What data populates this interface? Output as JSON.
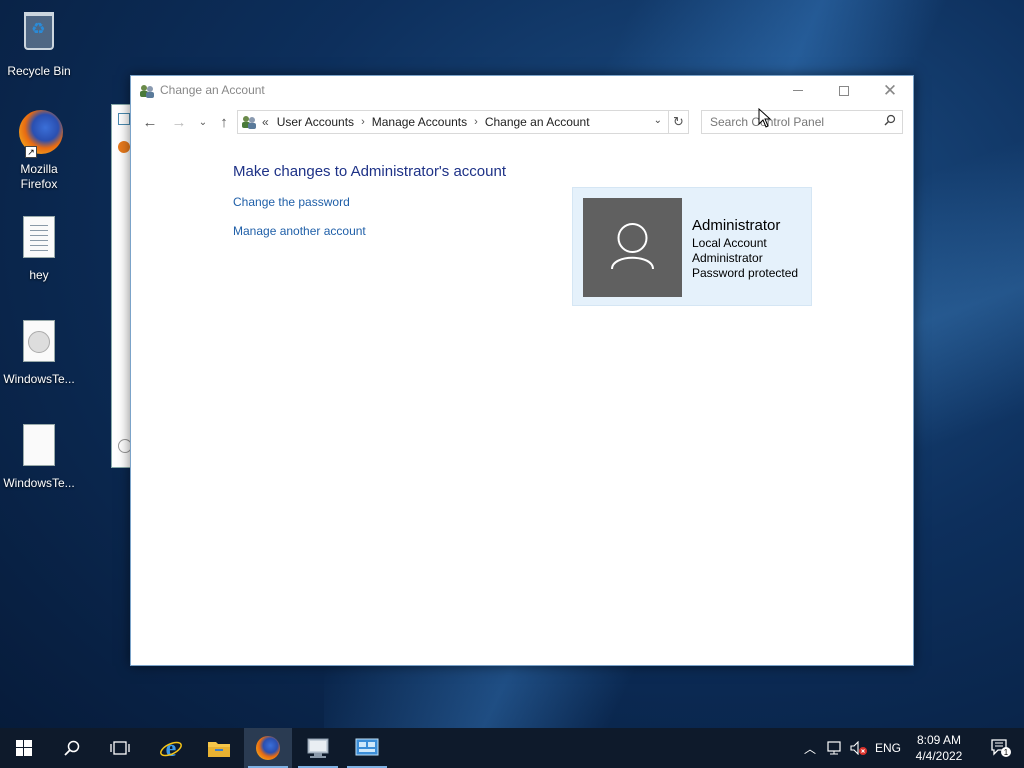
{
  "desktop": {
    "icons": [
      {
        "label": "Recycle Bin"
      },
      {
        "label": "Mozilla Firefox"
      },
      {
        "label": "hey"
      },
      {
        "label": "WindowsTe..."
      },
      {
        "label": "WindowsTe..."
      }
    ]
  },
  "window": {
    "title": "Change an Account",
    "breadcrumb": {
      "overflow": "«",
      "items": [
        "User Accounts",
        "Manage Accounts",
        "Change an Account"
      ]
    },
    "search_placeholder": "Search Control Panel",
    "heading": "Make changes to Administrator's account",
    "links": [
      "Change the password",
      "Manage another account"
    ],
    "account": {
      "name": "Administrator",
      "details": [
        "Local Account",
        "Administrator",
        "Password protected"
      ]
    }
  },
  "taskbar": {
    "language": "ENG",
    "time": "8:09 AM",
    "date": "4/4/2022",
    "notification_count": "1"
  },
  "colors": {
    "link": "#1f5fa8",
    "heading": "#1e3287",
    "card_bg": "#e5f1fb",
    "avatar_bg": "#606060",
    "taskbar_bg": "#0e1a2b"
  }
}
